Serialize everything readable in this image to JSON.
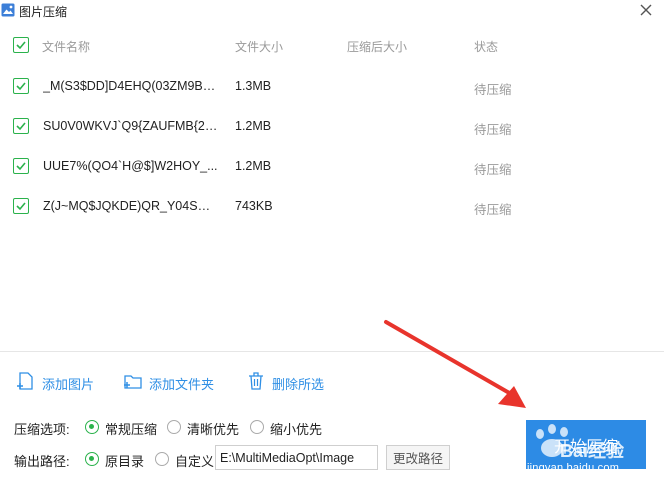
{
  "window": {
    "title": "图片压缩"
  },
  "table": {
    "headers": {
      "name": "文件名称",
      "size": "文件大小",
      "compressed_size": "压缩后大小",
      "status": "状态"
    },
    "rows": [
      {
        "name": "_M(S3$DD]D4EHQ(03ZM9B_...",
        "size": "1.3MB",
        "compressed_size": "",
        "status": "待压缩"
      },
      {
        "name": "SU0V0WKVJ`Q9{ZAUFMB{23...",
        "size": "1.2MB",
        "compressed_size": "",
        "status": "待压缩"
      },
      {
        "name": "UUE7%(QO4`H@$]W2HOY_...",
        "size": "1.2MB",
        "compressed_size": "",
        "status": "待压缩"
      },
      {
        "name": "Z(J~MQ$JQKDE)QR_Y04SGE...",
        "size": "743KB",
        "compressed_size": "",
        "status": "待压缩"
      }
    ]
  },
  "actions": {
    "add_image": "添加图片",
    "add_folder": "添加文件夹",
    "delete_selected": "删除所选"
  },
  "compress_options": {
    "label": "压缩选项:",
    "options": [
      "常规压缩",
      "清晰优先",
      "缩小优先"
    ],
    "selected": "常规压缩"
  },
  "output_path": {
    "label": "输出路径:",
    "options": [
      "原目录",
      "自定义"
    ],
    "selected": "原目录",
    "value": "E:\\MultiMediaOpt\\Image",
    "change_label": "更改路径"
  },
  "start_button": {
    "label": "开始压缩"
  },
  "watermark": {
    "text": "Bai经验",
    "url": "jingyan.baidu.com"
  },
  "colors": {
    "accent": "#2d8be5",
    "check_green": "#2bb24c",
    "arrow_red": "#e8342c"
  },
  "icons": [
    "app-icon",
    "close-icon",
    "checkbox-checked-icon",
    "add-image-icon",
    "add-folder-icon",
    "trash-icon"
  ]
}
